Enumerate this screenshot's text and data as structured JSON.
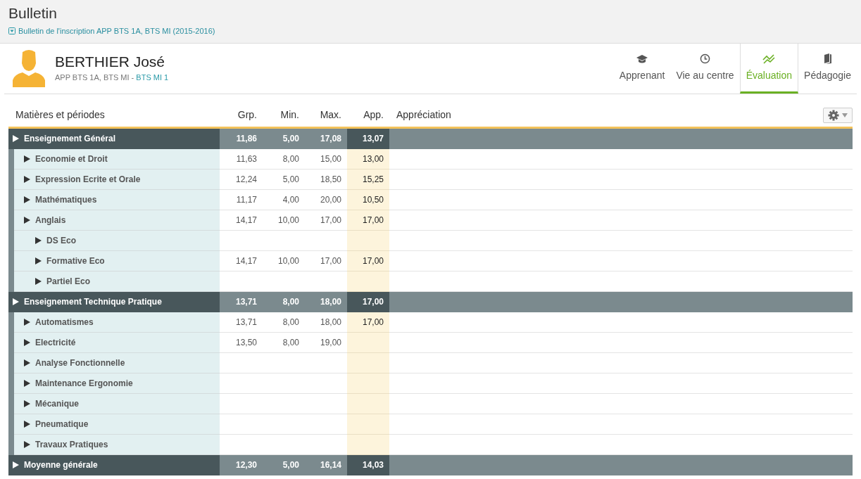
{
  "page": {
    "title": "Bulletin",
    "subtitle": "Bulletin de l'inscription APP BTS 1A, BTS MI (2015-2016)"
  },
  "student": {
    "name": "BERTHIER José",
    "program": "APP BTS 1A, BTS MI - ",
    "group_link": "BTS MI 1"
  },
  "tabs": [
    {
      "label": "Apprenant",
      "selected": false
    },
    {
      "label": "Vie au centre",
      "selected": false
    },
    {
      "label": "Évaluation",
      "selected": true
    },
    {
      "label": "Pédagogie",
      "selected": false
    }
  ],
  "table": {
    "columns": [
      "Matières et périodes",
      "Grp.",
      "Min.",
      "Max.",
      "App.",
      "Appréciation"
    ],
    "rows": [
      {
        "kind": "group",
        "label": "Enseignement Général",
        "grp": "11,86",
        "min": "5,00",
        "max": "17,08",
        "app": "13,07",
        "children": [
          {
            "label": "Economie et Droit",
            "grp": "11,63",
            "min": "8,00",
            "max": "15,00",
            "app": "13,00"
          },
          {
            "label": "Expression Ecrite et Orale",
            "grp": "12,24",
            "min": "5,00",
            "max": "18,50",
            "app": "15,25"
          },
          {
            "label": "Mathématiques",
            "grp": "11,17",
            "min": "4,00",
            "max": "20,00",
            "app": "10,50"
          },
          {
            "label": "Anglais",
            "grp": "14,17",
            "min": "10,00",
            "max": "17,00",
            "app": "17,00",
            "children": [
              {
                "label": "DS Eco"
              },
              {
                "label": "Formative Eco",
                "grp": "14,17",
                "min": "10,00",
                "max": "17,00",
                "app": "17,00"
              },
              {
                "label": "Partiel Eco"
              }
            ]
          }
        ]
      },
      {
        "kind": "group",
        "label": "Enseignement Technique Pratique",
        "grp": "13,71",
        "min": "8,00",
        "max": "18,00",
        "app": "17,00",
        "children": [
          {
            "label": "Automatismes",
            "grp": "13,71",
            "min": "8,00",
            "max": "18,00",
            "app": "17,00"
          },
          {
            "label": "Electricité",
            "grp": "13,50",
            "min": "8,00",
            "max": "19,00"
          },
          {
            "label": "Analyse Fonctionnelle"
          },
          {
            "label": "Maintenance Ergonomie"
          },
          {
            "label": "Mécanique"
          },
          {
            "label": "Pneumatique"
          },
          {
            "label": "Travaux Pratiques"
          }
        ]
      },
      {
        "kind": "group",
        "label": "Moyenne générale",
        "grp": "12,30",
        "min": "5,00",
        "max": "16,14",
        "app": "14,03"
      }
    ]
  }
}
